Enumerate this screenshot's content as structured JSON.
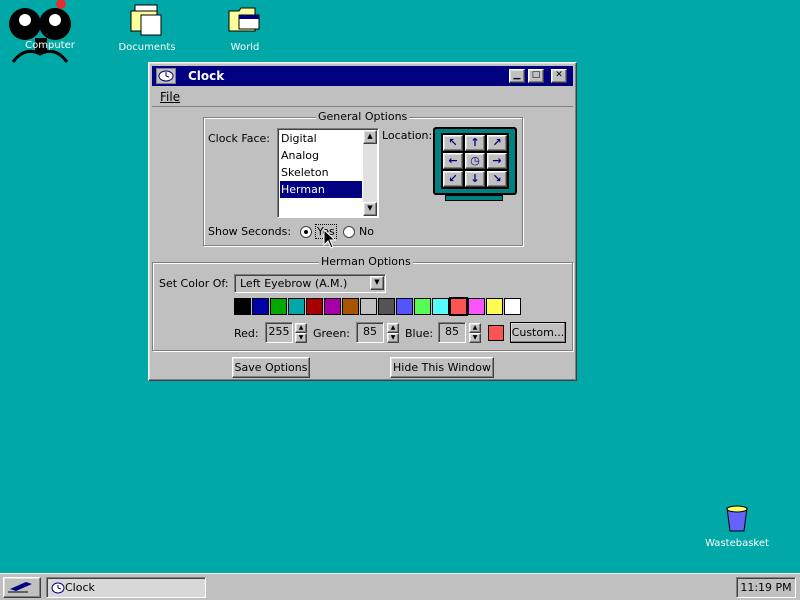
{
  "desktop": {
    "icons": [
      {
        "label": "Computer"
      },
      {
        "label": "Documents"
      },
      {
        "label": "World"
      },
      {
        "label": "Wastebasket"
      }
    ]
  },
  "window": {
    "title": "Clock",
    "menu": {
      "file": "File"
    },
    "general_options": {
      "title": "General Options",
      "clock_face_label": "Clock Face:",
      "clock_faces": [
        "Digital",
        "Analog",
        "Skeleton",
        "Herman"
      ],
      "selected_face": "Herman",
      "location_label": "Location:",
      "show_seconds_label": "Show Seconds:",
      "yes_label": "Yes",
      "no_label": "No",
      "show_seconds_value": "Yes"
    },
    "herman_options": {
      "title": "Herman Options",
      "set_color_label": "Set Color Of:",
      "set_color_value": "Left Eyebrow (A.M.)",
      "palette": [
        "#000000",
        "#0000a8",
        "#00a800",
        "#00a8a8",
        "#a80000",
        "#a800a8",
        "#a85400",
        "#c0c0c0",
        "#545454",
        "#5454fc",
        "#54fc54",
        "#54fcfc",
        "#fc5454",
        "#fc54fc",
        "#fcfc54",
        "#ffffff"
      ],
      "selected_swatch_index": 12,
      "red_label": "Red:",
      "red_value": "255",
      "green_label": "Green:",
      "green_value": "85",
      "blue_label": "Blue:",
      "blue_value": "85",
      "preview_color": "#fc5454",
      "custom_label": "Custom..."
    },
    "save_options_label": "Save Options",
    "hide_window_label": "Hide This Window"
  },
  "taskbar": {
    "task_label": "Clock",
    "time": "11:19 PM"
  },
  "colors": {
    "desktop": "#00a8a8",
    "titlebar": "#000080",
    "window": "#c0c0c0",
    "selection": "#000080"
  }
}
